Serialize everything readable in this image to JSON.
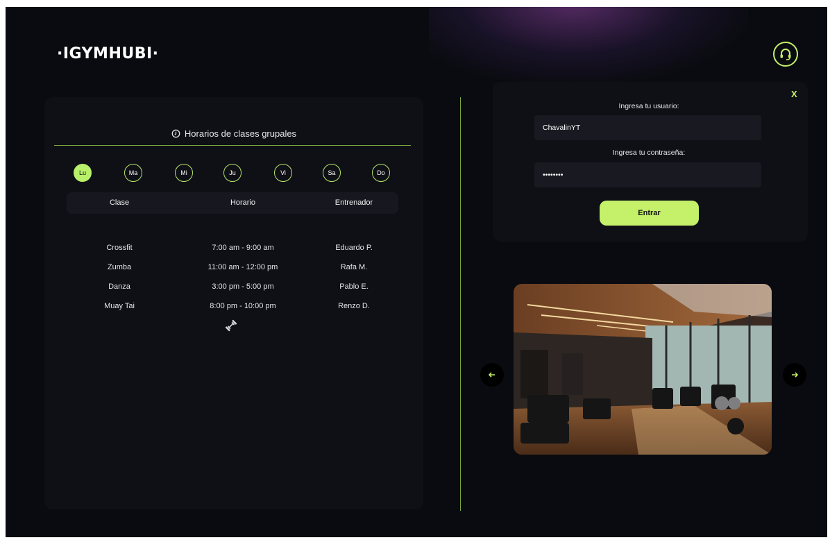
{
  "brand": {
    "logo_text": "·IGYMHUBI·"
  },
  "header": {
    "support_icon": "headset-icon",
    "accent": "#c4f06a"
  },
  "schedule": {
    "title": "Horarios de clases grupales",
    "title_icon": "clock-icon",
    "days": [
      {
        "label": "Lu",
        "active": true
      },
      {
        "label": "Ma",
        "active": false
      },
      {
        "label": "Mi",
        "active": false
      },
      {
        "label": "Ju",
        "active": false
      },
      {
        "label": "Vi",
        "active": false
      },
      {
        "label": "Sa",
        "active": false
      },
      {
        "label": "Do",
        "active": false
      }
    ],
    "columns": [
      "Clase",
      "Horario",
      "Entrenador"
    ],
    "rows": [
      {
        "clase": "Crossfit",
        "horario": "7:00 am - 9:00 am",
        "entrenador": "Eduardo P."
      },
      {
        "clase": "Zumba",
        "horario": "11:00 am - 12:00 pm",
        "entrenador": "Rafa M."
      },
      {
        "clase": "Danza",
        "horario": "3:00 pm - 5:00 pm",
        "entrenador": "Pablo E."
      },
      {
        "clase": "Muay Tai",
        "horario": "8:00 pm - 10:00 pm",
        "entrenador": "Renzo D."
      }
    ],
    "footer_icon": "dumbbell-icon"
  },
  "login": {
    "close_label": "X",
    "user_label": "Ingresa tu usuario:",
    "user_value": "ChavalinYT",
    "password_label": "Ingresa tu contraseña:",
    "password_value": "••••••••",
    "submit_label": "Entrar"
  },
  "carousel": {
    "image": "gym-interior-photo",
    "prev_icon": "arrow-left-icon",
    "next_icon": "arrow-right-icon"
  }
}
